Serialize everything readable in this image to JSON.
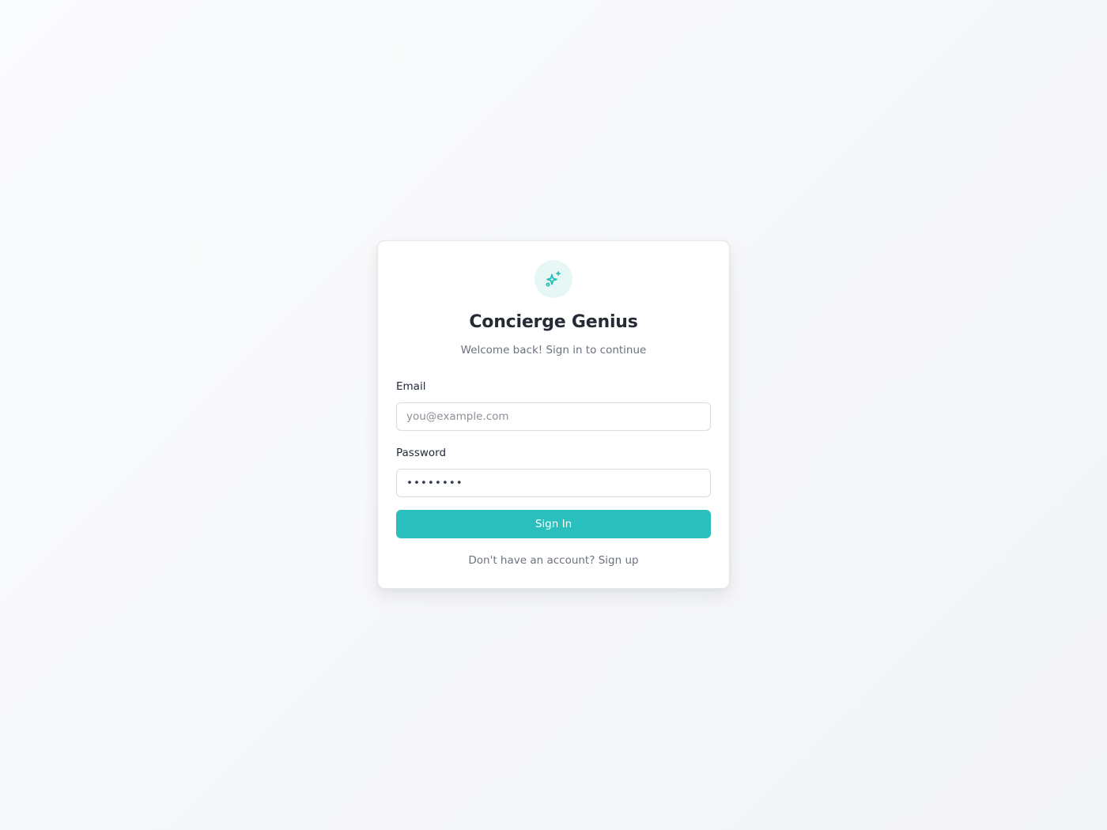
{
  "app": {
    "title": "Concierge Genius",
    "subtitle": "Welcome back! Sign in to continue",
    "logo_icon": "sparkles-icon"
  },
  "form": {
    "email": {
      "label": "Email",
      "placeholder": "you@example.com",
      "value": ""
    },
    "password": {
      "label": "Password",
      "value": "••••••••"
    },
    "submit_label": "Sign In"
  },
  "footer": {
    "prompt": "Don't have an account?",
    "link_label": "Sign up"
  },
  "colors": {
    "accent": "#2abfbc",
    "accent_soft": "#e6f7f6",
    "title": "#252b35",
    "muted": "#6b7280"
  }
}
